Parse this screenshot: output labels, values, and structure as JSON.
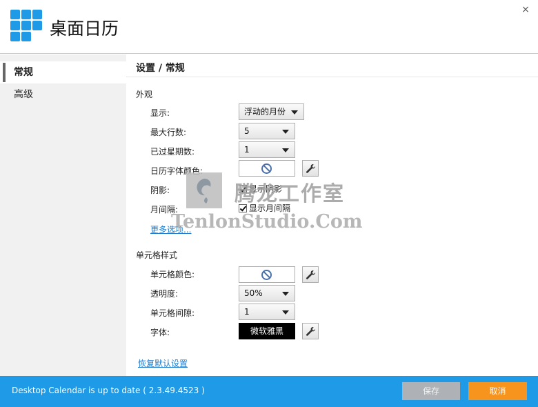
{
  "app": {
    "title": "桌面日历",
    "close_glyph": "×"
  },
  "sidebar": {
    "items": [
      {
        "label": "常规",
        "active": true
      },
      {
        "label": "高级",
        "active": false
      }
    ]
  },
  "breadcrumb": "设置 / 常规",
  "appearance": {
    "title": "外观",
    "display_label": "显示:",
    "display_value": "浮动的月份",
    "max_rows_label": "最大行数:",
    "max_rows_value": "5",
    "past_weeks_label": "已过星期数:",
    "past_weeks_value": "1",
    "font_color_label": "日历字体颜色:",
    "shadow_label": "阴影:",
    "shadow_checkbox": "显示阴影",
    "shadow_checked": true,
    "month_gap_label": "月间隔:",
    "month_gap_checkbox": "显示月间隔",
    "month_gap_checked": true,
    "more_options": "更多选项..."
  },
  "cell_style": {
    "title": "单元格样式",
    "cell_color_label": "单元格颜色:",
    "opacity_label": "透明度:",
    "opacity_value": "50%",
    "cell_gap_label": "单元格间隙:",
    "cell_gap_value": "1",
    "font_label": "字体:",
    "font_value": "微软雅黑"
  },
  "restore_defaults": "恢复默认设置",
  "watermark": {
    "cn": "腾龙工作室",
    "en": "TenlonStudio.Com"
  },
  "status": {
    "text": "Desktop Calendar is up to date ( 2.3.49.4523 )",
    "save_label": "保存",
    "cancel_label": "取消"
  },
  "colors": {
    "accent": "#1e9ae6",
    "cancel": "#f7941d",
    "save_disabled": "#aeb2b6"
  },
  "icons": [
    "app-logo-icon",
    "close-icon",
    "dropdown-arrow-icon",
    "no-color-icon",
    "wrench-icon",
    "checkbox-icon"
  ]
}
